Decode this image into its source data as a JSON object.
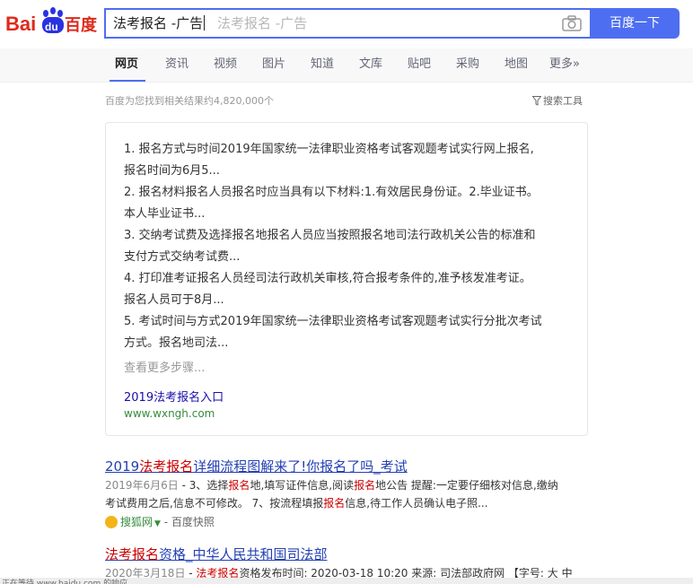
{
  "header": {
    "logo_text_en": "Bai",
    "logo_text_paw": "du",
    "logo_text_cn": "百度",
    "query": "法考报名 -广告",
    "ghost_query": "法考报名 -广告",
    "search_button": "百度一下",
    "camera_icon": "camera-icon"
  },
  "tabs": [
    {
      "label": "网页",
      "active": true
    },
    {
      "label": "资讯"
    },
    {
      "label": "视频"
    },
    {
      "label": "图片"
    },
    {
      "label": "知道"
    },
    {
      "label": "文库"
    },
    {
      "label": "贴吧"
    },
    {
      "label": "采购"
    },
    {
      "label": "地图"
    },
    {
      "label": "更多»"
    }
  ],
  "result_count": "百度为您找到相关结果约4,820,000个",
  "search_tools": "搜索工具",
  "card": {
    "lines": [
      "1. 报名方式与时间2019年国家统一法律职业资格考试客观题考试实行网上报名,",
      "报名时间为6月5...",
      "2. 报名材料报名人员报名时应当具有以下材料:1.有效居民身份证。2.毕业证书。",
      "本人毕业证书...",
      "3. 交纳考试费及选择报名地报名人员应当按照报名地司法行政机关公告的标准和",
      "支付方式交纳考试费...",
      "4. 打印准考证报名人员经司法行政机关审核,符合报考条件的,准予核发准考证。",
      "报名人员可于8月...",
      "5. 考试时间与方式2019年国家统一法律职业资格考试客观题考试实行分批次考试",
      "方式。报名地司法..."
    ],
    "more_steps": "查看更多步骤...",
    "link": "2019法考报名入口",
    "url": "www.wxngh.com"
  },
  "results": [
    {
      "title_pre": "2019",
      "title_em": "法考报名",
      "title_post": "详细流程图解来了!你报名了吗_考试",
      "date": "2019年6月6日",
      "desc1_a": " - 3、选择",
      "desc1_em1": "报名",
      "desc1_b": "地,填写证件信息,阅读",
      "desc1_em2": "报名",
      "desc1_c": "地公告 提醒:一定要仔细核对信息,缴纳",
      "desc2_a": "考试费用之后,信息不可修改。 7、按流程填报",
      "desc2_em": "报名",
      "desc2_b": "信息,待工作人员确认电子照...",
      "source": "搜狐网",
      "cache": " - 百度快照"
    },
    {
      "title_em": "法考报名",
      "title_post": "资格_中华人民共和国司法部",
      "date": "2020年3月18日",
      "desc1_a": " - ",
      "desc1_em1": "法考报名",
      "desc1_b": "资格发布时间: 2020-03-18 10:20 来源: 司法部政府网 【字号: 大 中"
    }
  ],
  "status_bar": "正在等待 www.baidu.com 的响应..."
}
